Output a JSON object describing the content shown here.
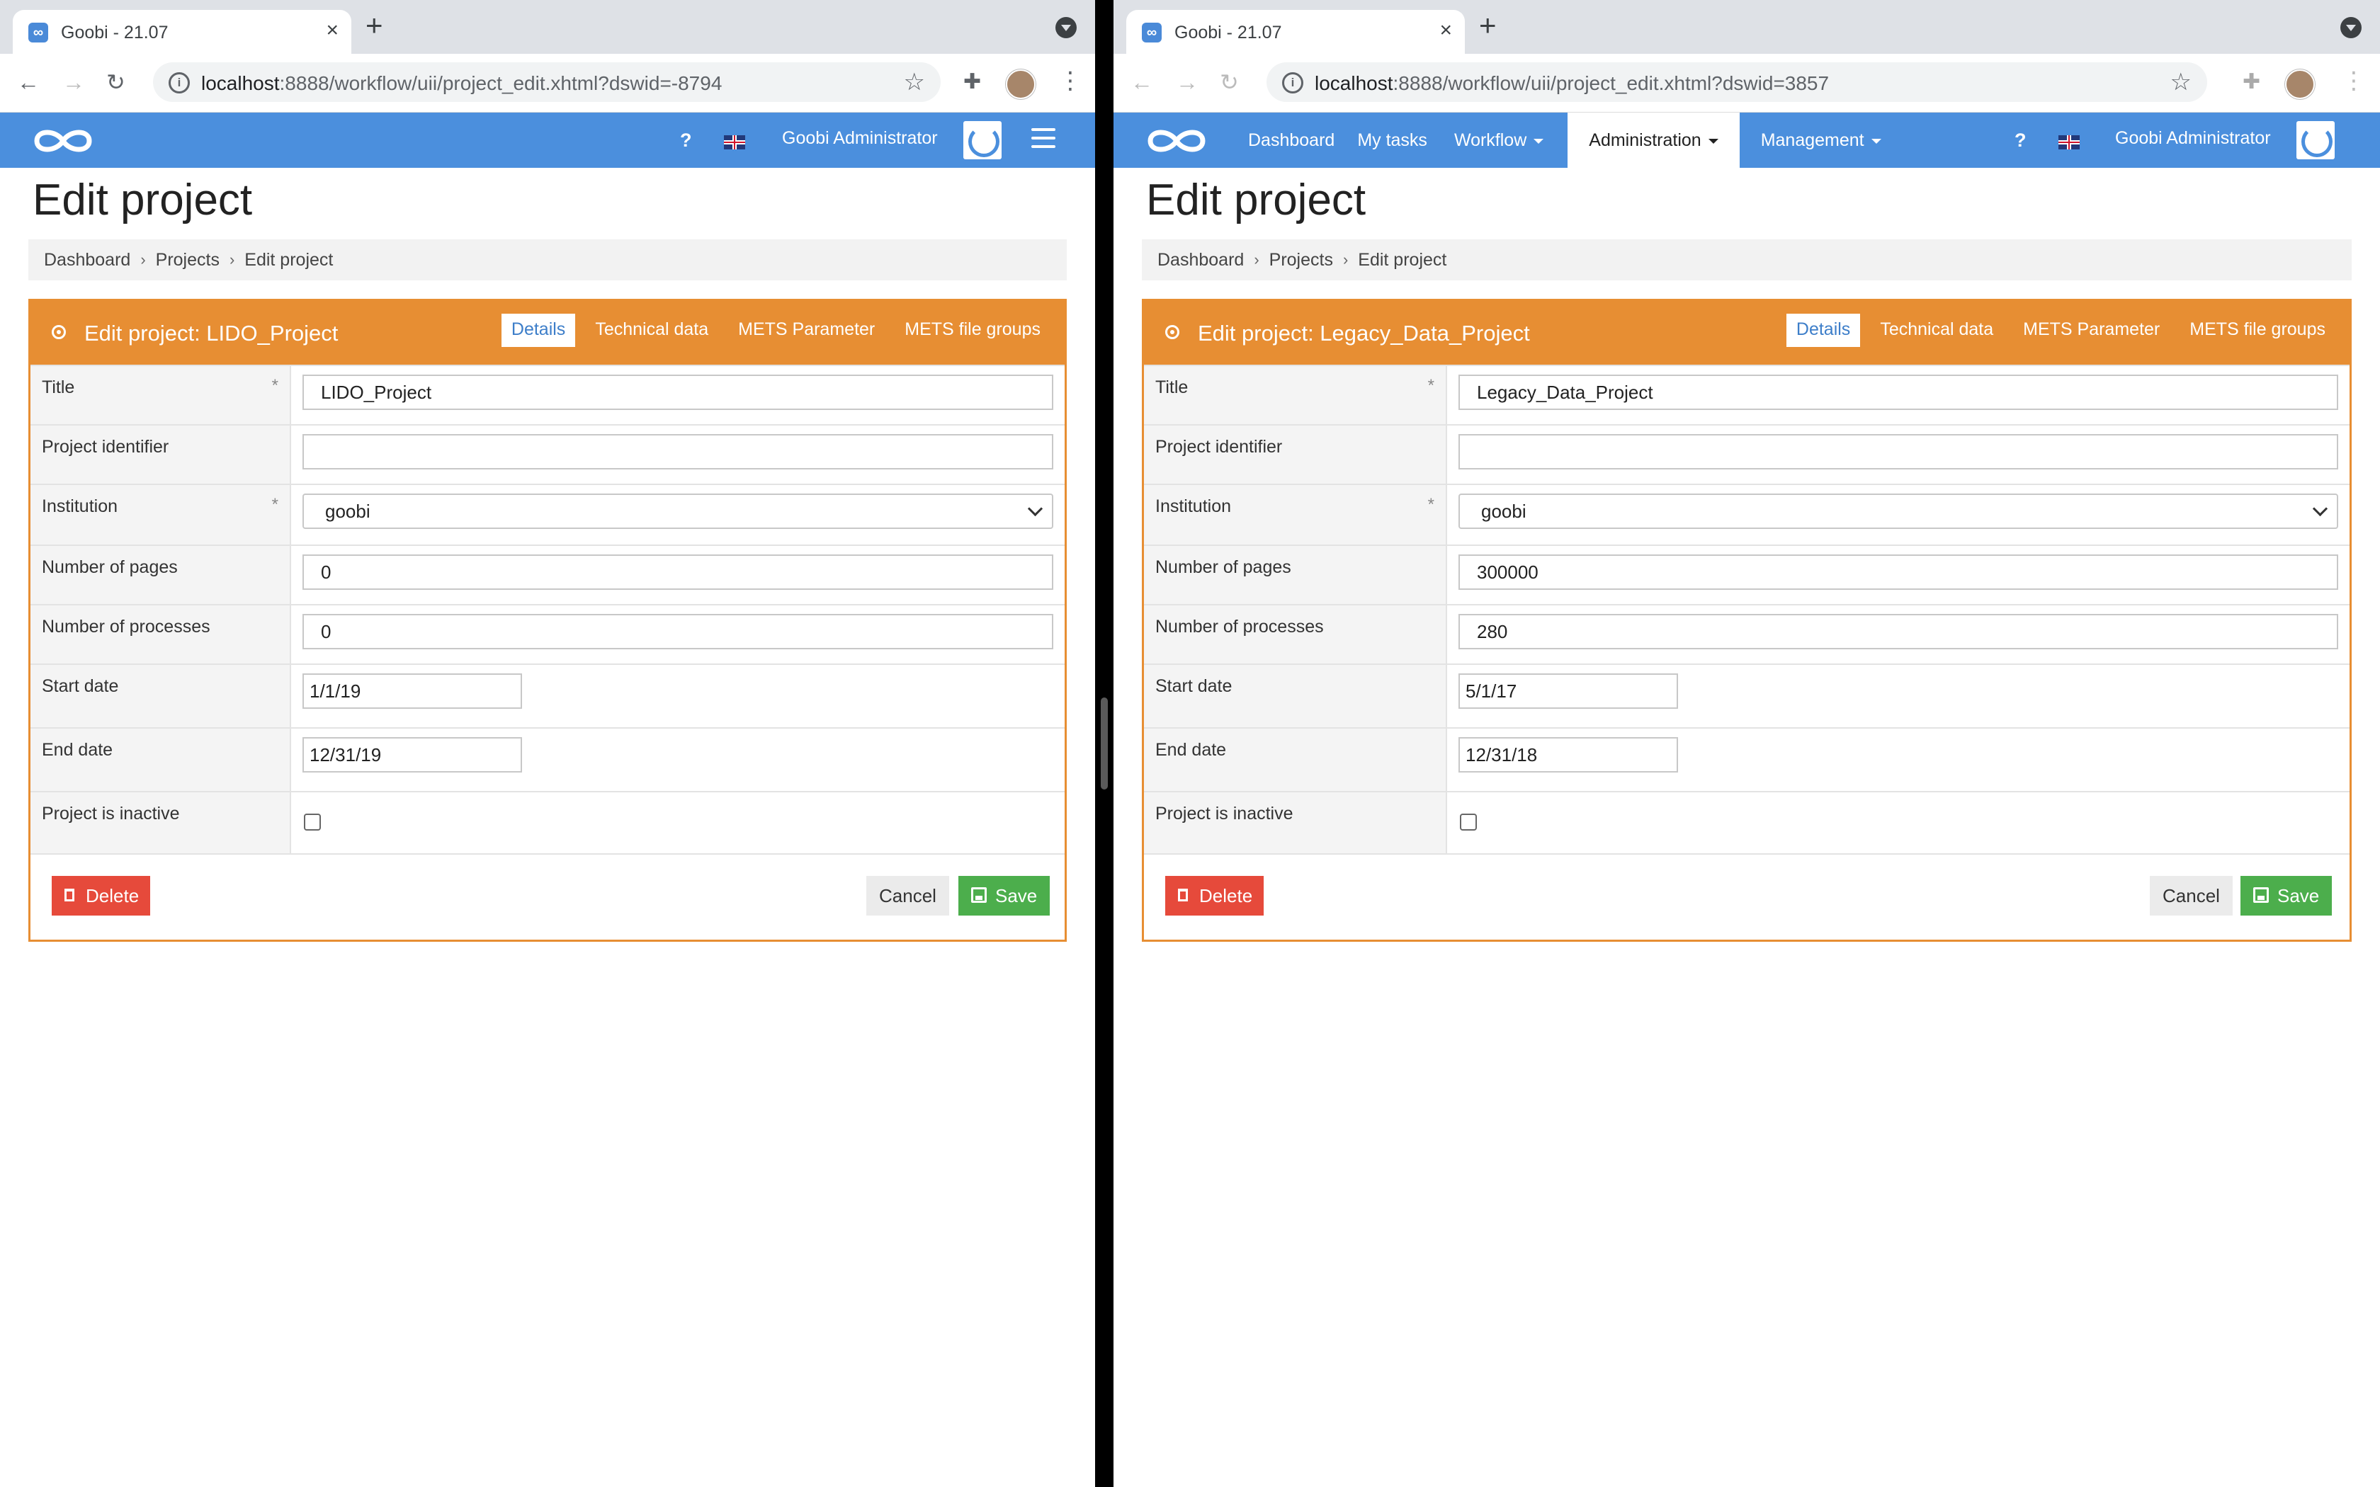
{
  "left": {
    "tab_title": "Goobi - 21.07",
    "url_host": "localhost",
    "url_rest": ":8888/workflow/uii/project_edit.xhtml?dswid=-8794",
    "nav": [],
    "help": "?",
    "user": "Goobi Administrator",
    "page_title": "Edit project",
    "breadcrumb": [
      "Dashboard",
      "Projects",
      "Edit project"
    ],
    "panel_title": "Edit project: LIDO_Project",
    "tabs": [
      "Details",
      "Technical data",
      "METS Parameter",
      "METS file groups"
    ],
    "fields": {
      "title_label": "Title",
      "title_value": "LIDO_Project",
      "identifier_label": "Project identifier",
      "identifier_value": "",
      "institution_label": "Institution",
      "institution_value": "goobi",
      "pages_label": "Number of pages",
      "pages_value": "0",
      "processes_label": "Number of processes",
      "processes_value": "0",
      "start_label": "Start date",
      "start_value": "1/1/19",
      "end_label": "End date",
      "end_value": "12/31/19",
      "inactive_label": "Project is inactive",
      "required_mark": "*"
    },
    "buttons": {
      "delete": "Delete",
      "cancel": "Cancel",
      "save": "Save"
    }
  },
  "right": {
    "tab_title": "Goobi - 21.07",
    "url_host": "localhost",
    "url_rest": ":8888/workflow/uii/project_edit.xhtml?dswid=3857",
    "nav": [
      "Dashboard",
      "My tasks",
      "Workflow",
      "Administration",
      "Management"
    ],
    "help": "?",
    "user": "Goobi Administrator",
    "page_title": "Edit project",
    "breadcrumb": [
      "Dashboard",
      "Projects",
      "Edit project"
    ],
    "panel_title": "Edit project: Legacy_Data_Project",
    "tabs": [
      "Details",
      "Technical data",
      "METS Parameter",
      "METS file groups"
    ],
    "fields": {
      "title_label": "Title",
      "title_value": "Legacy_Data_Project",
      "identifier_label": "Project identifier",
      "identifier_value": "",
      "institution_label": "Institution",
      "institution_value": "goobi",
      "pages_label": "Number of pages",
      "pages_value": "300000",
      "processes_label": "Number of processes",
      "processes_value": "280",
      "start_label": "Start date",
      "start_value": "5/1/17",
      "end_label": "End date",
      "end_value": "12/31/18",
      "inactive_label": "Project is inactive",
      "required_mark": "*"
    },
    "buttons": {
      "delete": "Delete",
      "cancel": "Cancel",
      "save": "Save"
    }
  },
  "colors": {
    "header": "#4b8fdd",
    "panel": "#e78e33",
    "delete": "#e64a3b",
    "save": "#4cae4c"
  }
}
